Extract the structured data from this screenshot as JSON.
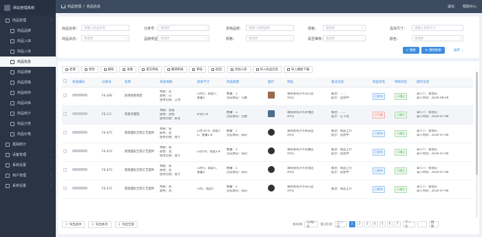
{
  "app": {
    "title": "网站管理系统"
  },
  "colors": {
    "accent": "#3c8dde",
    "sidebar": "#2b3445",
    "topbar": "#3b4a5e"
  },
  "sidebar": {
    "items": [
      {
        "label": "商品管理",
        "icon": "grid-icon",
        "level": 0
      },
      {
        "label": "商品品牌",
        "icon": "tag-icon",
        "level": 1
      },
      {
        "label": "商品入库",
        "icon": "inbox-icon",
        "level": 1
      },
      {
        "label": "商品入库",
        "icon": "inbox-icon",
        "level": 1
      },
      {
        "label": "商品信息",
        "icon": "list-icon",
        "level": 1,
        "active": true
      },
      {
        "label": "商品搜索",
        "icon": "search-icon",
        "level": 1
      },
      {
        "label": "商品规格",
        "icon": "sliders-icon",
        "level": 1
      },
      {
        "label": "商品库存",
        "icon": "box-icon",
        "level": 1
      },
      {
        "label": "商品出库",
        "icon": "outbox-icon",
        "level": 1
      },
      {
        "label": "商品统计",
        "icon": "chart-icon",
        "level": 1
      },
      {
        "label": "商品分类",
        "icon": "folder-icon",
        "level": 1
      },
      {
        "label": "商品价格",
        "icon": "price-icon",
        "level": 1
      },
      {
        "label": "基础统计",
        "icon": "stats-icon",
        "level": 0
      },
      {
        "label": "设备管理",
        "icon": "device-icon",
        "level": 0
      },
      {
        "label": "系统设置",
        "icon": "gear-icon",
        "level": 0
      },
      {
        "label": "用户管理",
        "icon": "user-icon",
        "level": 0
      },
      {
        "label": "系统设置",
        "icon": "gear-icon",
        "level": 0
      }
    ]
  },
  "topbar": {
    "breadcrumb": [
      "商品管理",
      "商品信息"
    ],
    "right": [
      "退出",
      "帮助中心"
    ]
  },
  "filters": {
    "row1": [
      {
        "label": "商品名称：",
        "placeholder": "请输入商品名称"
      },
      {
        "label": "分类号：",
        "placeholder": "请选择"
      },
      {
        "label": "货物品牌：",
        "placeholder": "请输入货物品牌"
      },
      {
        "label": "规格：",
        "placeholder": "请选择"
      },
      {
        "label": "具体尺寸：",
        "placeholder": "请输入具体尺寸"
      }
    ],
    "row2": [
      {
        "label": "商品状态：",
        "placeholder": "请选择"
      },
      {
        "label": "品牌类型：",
        "placeholder": "请选择"
      },
      {
        "label": "规格：",
        "placeholder": "请选择"
      },
      {
        "label": "是否推荐：",
        "placeholder": "请选择"
      },
      {
        "label": "颜色：",
        "placeholder": "请选择"
      }
    ],
    "search_label": "搜索",
    "reset_label": "清除搜索",
    "more_label": "展开"
  },
  "toolbar": [
    {
      "label": "新增",
      "icon": "plus-icon"
    },
    {
      "label": "修改",
      "icon": "edit-icon"
    },
    {
      "label": "删除",
      "icon": "trash-icon"
    },
    {
      "label": "查看",
      "icon": "eye-icon"
    },
    {
      "label": "提交审核",
      "icon": "send-icon"
    },
    {
      "label": "撤销审核",
      "icon": "undo-icon"
    },
    {
      "label": "审核",
      "icon": "check-icon"
    },
    {
      "label": "驳回",
      "icon": "reject-icon"
    },
    {
      "label": "添加入库",
      "icon": "inbox-icon"
    },
    {
      "label": "导入商品信息",
      "icon": "import-icon"
    },
    {
      "label": "导入模板下载",
      "icon": "download-icon"
    }
  ],
  "table": {
    "headers": [
      "",
      "商品编号",
      "分类号",
      "名称",
      "商品规格",
      "具体尺寸",
      "商品质量",
      "图片",
      "地址",
      "备注信息",
      "商品状态",
      "审核状态",
      "操作信息"
    ],
    "rows": [
      {
        "code": "FE-306",
        "name": "防滑地毯地垫",
        "spec": [
          "材质：尼",
          "颜色：白",
          "使用范围：卫浴"
        ],
        "size": [
          "口径5，高度5，",
          "重量5"
        ],
        "quality": [
          "数量：1",
          "完成情况：完整"
        ],
        "img": "brown",
        "addr": [
          "湖南省长沙市天心区",
          "XX号"
        ],
        "note": [
          "备注：……",
          "提示：运营中"
        ],
        "status": "已发布",
        "status_type": "blue",
        "audit": "已通过",
        "ops": [
          "录入人：管理员",
          "录入时间：2020-08-06"
        ]
      },
      {
        "code": "FE-1-5",
        "name": "简易衣帽架",
        "spec": [
          "材质：金属",
          "颜色：黑色",
          "使用范围：卧室"
        ],
        "size": [
          "外径174"
        ],
        "quality": [
          "数量：1",
          "完成情况：完整"
        ],
        "img": "blue",
        "addr": [
          "湖南省长沙市开福区",
          "XX号"
        ],
        "note": [
          "备注：……",
          "提示：已下架"
        ],
        "status": "已下架",
        "status_type": "red",
        "audit": "已通过",
        "ops": [
          "录入人：管理员",
          "录入时间：2020-07-08"
        ]
      },
      {
        "code": "FE-075",
        "name": "新款圆形全铁工艺摆件",
        "spec": [
          "材质：铁",
          "颜色：黑",
          "使用范围：客厅"
        ],
        "size": [
          "口径10.4，高度1",
          "0，重量1.8"
        ],
        "quality": [
          "数量：1",
          "完成情况：缺货"
        ],
        "img": "dark",
        "addr": [
          "湖南省长沙市雨花区",
          "XX号"
        ],
        "note": [
          "备注：新品上市",
          "提示：运营中"
        ],
        "status": "已发布",
        "status_type": "blue",
        "audit": "已通过",
        "ops": [
          "录入人：管理员",
          "录入时间：2020-07-08"
        ]
      },
      {
        "code": "FE-074",
        "name": "新款圆形全铁工艺摆件",
        "spec": [
          "材质：铁",
          "颜色：黑",
          "使用范围：客厅"
        ],
        "size": [
          "口径10，高度2.8"
        ],
        "quality": [
          "数量：1",
          "完成情况：缺货"
        ],
        "img": "dark",
        "addr": [
          "湖南省长沙市岳麓区",
          "XX号"
        ],
        "note": [
          "备注：新品上市",
          "提示：运营中"
        ],
        "status": "已发布",
        "status_type": "blue",
        "audit": "已通过",
        "ops": [
          "录入人：管理员",
          "录入时间：2020-07-08"
        ]
      },
      {
        "code": "FE-073",
        "name": "新款圆形全铁工艺摆件",
        "spec": [
          "材质：铁",
          "颜色：黑",
          "使用范围：客厅"
        ],
        "size": [
          "口径5，高度5，",
          "重量5"
        ],
        "quality": [
          "数量：1",
          "完成情况：缺货"
        ],
        "img": "dark",
        "addr": [
          "湖南省长沙市芙蓉区",
          "XX号"
        ],
        "note": [
          "备注：新品上市",
          "提示：运营中"
        ],
        "status": "已发布",
        "status_type": "blue",
        "audit": "已通过",
        "ops": [
          "录入人：管理员",
          "录入时间：2020-07-08"
        ]
      },
      {
        "code": "FE-072",
        "name": "新款圆形全铁工艺摆件",
        "spec": [
          "材质：铁",
          "颜色：黑"
        ],
        "size": [
          "口径，高度5"
        ],
        "quality": [
          "数量：2",
          "完成情况：缺货"
        ],
        "img": "dark",
        "addr": [
          "湖南省长沙市天心区",
          "XX号"
        ],
        "note": [
          "备注：新品上市"
        ],
        "status": "已发布",
        "status_type": "blue",
        "audit": "已通过",
        "ops": [
          "录入人：管理员",
          "录入时间：2020-07-08"
        ]
      }
    ]
  },
  "footer": {
    "buttons": [
      "导出选中",
      "导出本页",
      "导出全部"
    ],
    "total": "共40条",
    "page_size": "10条/页",
    "first": "第1页/页",
    "prev": "上一页",
    "pages": [
      "1",
      "2",
      "3",
      "4",
      "5",
      "6",
      "7"
    ],
    "next": "下一页",
    "goto": "跳转"
  }
}
